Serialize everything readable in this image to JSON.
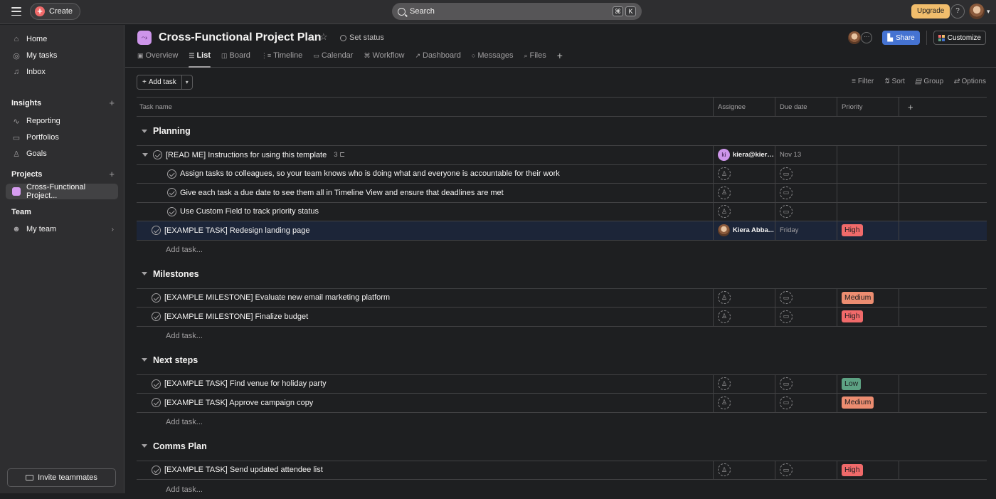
{
  "topbar": {
    "create_label": "Create",
    "search_placeholder": "Search",
    "shortcut_keys": [
      "⌘",
      "K"
    ],
    "upgrade_label": "Upgrade",
    "help_label": "?"
  },
  "sidebar": {
    "nav": [
      {
        "label": "Home",
        "icon": "home-icon"
      },
      {
        "label": "My tasks",
        "icon": "check-circle-icon"
      },
      {
        "label": "Inbox",
        "icon": "bell-icon"
      }
    ],
    "insights": {
      "title": "Insights",
      "items": [
        {
          "label": "Reporting",
          "icon": "chart-line-icon"
        },
        {
          "label": "Portfolios",
          "icon": "folder-icon"
        },
        {
          "label": "Goals",
          "icon": "goal-person-icon"
        }
      ]
    },
    "projects": {
      "title": "Projects",
      "items": [
        {
          "label": "Cross-Functional Project...",
          "color": "#d69cf0"
        }
      ]
    },
    "team": {
      "title": "Team",
      "items": [
        {
          "label": "My team",
          "icon": "team-icon"
        }
      ]
    },
    "invite_label": "Invite teammates"
  },
  "project": {
    "title": "Cross-Functional Project Plan",
    "set_status_label": "Set status",
    "tabs": [
      {
        "label": "Overview",
        "icon": "▣",
        "active": false
      },
      {
        "label": "List",
        "icon": "☰",
        "active": true
      },
      {
        "label": "Board",
        "icon": "◫",
        "active": false
      },
      {
        "label": "Timeline",
        "icon": "⋮≡",
        "active": false
      },
      {
        "label": "Calendar",
        "icon": "▭",
        "active": false
      },
      {
        "label": "Workflow",
        "icon": "⌘",
        "active": false
      },
      {
        "label": "Dashboard",
        "icon": "↗",
        "active": false
      },
      {
        "label": "Messages",
        "icon": "○",
        "active": false
      },
      {
        "label": "Files",
        "icon": "⌕",
        "active": false
      }
    ],
    "share_label": "Share",
    "customize_label": "Customize"
  },
  "toolbar": {
    "add_task_label": "Add task",
    "filter_label": "Filter",
    "sort_label": "Sort",
    "group_label": "Group",
    "options_label": "Options"
  },
  "columns": {
    "task_name": "Task name",
    "assignee": "Assignee",
    "due_date": "Due date",
    "priority": "Priority"
  },
  "priority_colors": {
    "High": "#f06a6a",
    "Medium": "#ec8d71",
    "Low": "#5da283"
  },
  "sections": [
    {
      "name": "Planning",
      "tasks": [
        {
          "name": "[READ ME] Instructions for using this template",
          "subtask_count": "3",
          "expanded": true,
          "assignee": "kiera@kiera...",
          "assignee_initials": "ki",
          "due": "Nov 13",
          "priority": ""
        },
        {
          "name": "Assign tasks to colleagues, so your team knows who is doing what and everyone is accountable for their work",
          "subtask": true,
          "assignee": "",
          "due": "",
          "priority": ""
        },
        {
          "name": "Give each task a due date to see them all in Timeline View and ensure that deadlines are met",
          "subtask": true,
          "assignee": "",
          "due": "",
          "priority": ""
        },
        {
          "name": "Use Custom Field to track priority status",
          "subtask": true,
          "assignee": "",
          "due": "",
          "priority": ""
        },
        {
          "name": "[EXAMPLE TASK] Redesign landing page",
          "assignee": "Kiera Abba...",
          "assignee_photo": true,
          "due": "Friday",
          "priority": "High",
          "highlight": true
        }
      ]
    },
    {
      "name": "Milestones",
      "tasks": [
        {
          "name": "[EXAMPLE MILESTONE] Evaluate new email marketing platform",
          "assignee": "",
          "due": "",
          "priority": "Medium"
        },
        {
          "name": "[EXAMPLE MILESTONE] Finalize budget",
          "assignee": "",
          "due": "",
          "priority": "High"
        }
      ]
    },
    {
      "name": "Next steps",
      "tasks": [
        {
          "name": "[EXAMPLE TASK] Find venue for holiday party",
          "assignee": "",
          "due": "",
          "priority": "Low"
        },
        {
          "name": "[EXAMPLE TASK] Approve campaign copy",
          "assignee": "",
          "due": "",
          "priority": "Medium"
        }
      ]
    },
    {
      "name": "Comms Plan",
      "tasks": [
        {
          "name": "[EXAMPLE TASK] Send updated attendee list",
          "assignee": "",
          "due": "",
          "priority": "High"
        }
      ]
    }
  ],
  "add_task_row_label": "Add task..."
}
